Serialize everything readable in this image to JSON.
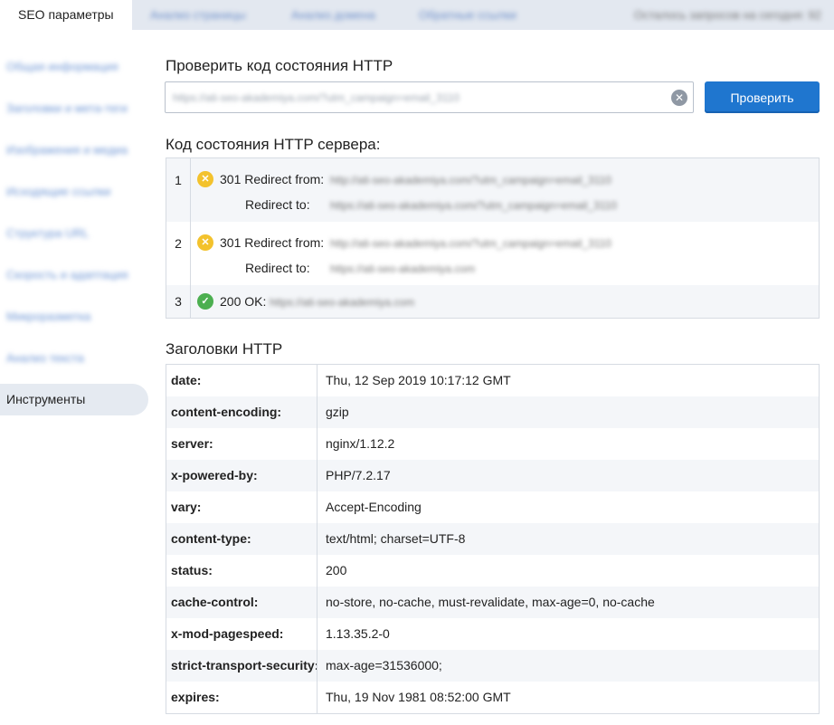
{
  "tabs": {
    "active": "SEO параметры",
    "others": [
      "Анализ страницы",
      "Анализ домена",
      "Обратные ссылки"
    ],
    "right_info": "Осталось запросов на сегодня: 92"
  },
  "sidebar": {
    "items": [
      {
        "label": "Общая информация"
      },
      {
        "label": "Заголовки и мета-теги"
      },
      {
        "label": "Изображения и медиа"
      },
      {
        "label": "Исходящие ссылки"
      },
      {
        "label": "Структура URL"
      },
      {
        "label": "Скорость и адаптация"
      },
      {
        "label": "Микроразметка"
      },
      {
        "label": "Анализ текста"
      },
      {
        "label": "Инструменты"
      }
    ],
    "active_index": 8
  },
  "check": {
    "title": "Проверить код состояния HTTP",
    "url_value": "https://ati-seo-akademiya.com/?utm_campaign=email_3110",
    "button_label": "Проверить"
  },
  "status": {
    "title": "Код состояния HTTP сервера:",
    "rows": [
      {
        "num": "1",
        "state": "warn",
        "code_label": "301 Redirect from:",
        "from_url": "http://ati-seo-akademiya.com/?utm_campaign=email_3110",
        "to_label": "Redirect to:",
        "to_url": "https://ati-seo-akademiya.com/?utm_campaign=email_3110"
      },
      {
        "num": "2",
        "state": "warn",
        "code_label": "301 Redirect from:",
        "from_url": "http://ati-seo-akademiya.com/?utm_campaign=email_3110",
        "to_label": "Redirect to:",
        "to_url": "https://ati-seo-akademiya.com"
      },
      {
        "num": "3",
        "state": "ok",
        "code_label": "200 OK:",
        "url": "https://ati-seo-akademiya.com"
      }
    ]
  },
  "headers": {
    "title": "Заголовки HTTP",
    "rows": [
      {
        "key": "date:",
        "value": "Thu, 12 Sep 2019 10:17:12 GMT"
      },
      {
        "key": "content-encoding:",
        "value": "gzip"
      },
      {
        "key": "server:",
        "value": "nginx/1.12.2"
      },
      {
        "key": "x-powered-by:",
        "value": "PHP/7.2.17"
      },
      {
        "key": "vary:",
        "value": "Accept-Encoding"
      },
      {
        "key": "content-type:",
        "value": "text/html; charset=UTF-8"
      },
      {
        "key": "status:",
        "value": "200"
      },
      {
        "key": "cache-control:",
        "value": "no-store, no-cache, must-revalidate, max-age=0, no-cache"
      },
      {
        "key": "x-mod-pagespeed:",
        "value": "1.13.35.2-0"
      },
      {
        "key": "strict-transport-security:",
        "value": "max-age=31536000;"
      },
      {
        "key": "expires:",
        "value": "Thu, 19 Nov 1981 08:52:00 GMT"
      }
    ]
  },
  "colors": {
    "accent": "#1f76cf",
    "warn": "#f3c22d",
    "ok": "#4caf50"
  },
  "icons": {
    "clear": "clear-circle-icon",
    "warn": "warning-circle-icon",
    "ok": "check-circle-icon"
  }
}
